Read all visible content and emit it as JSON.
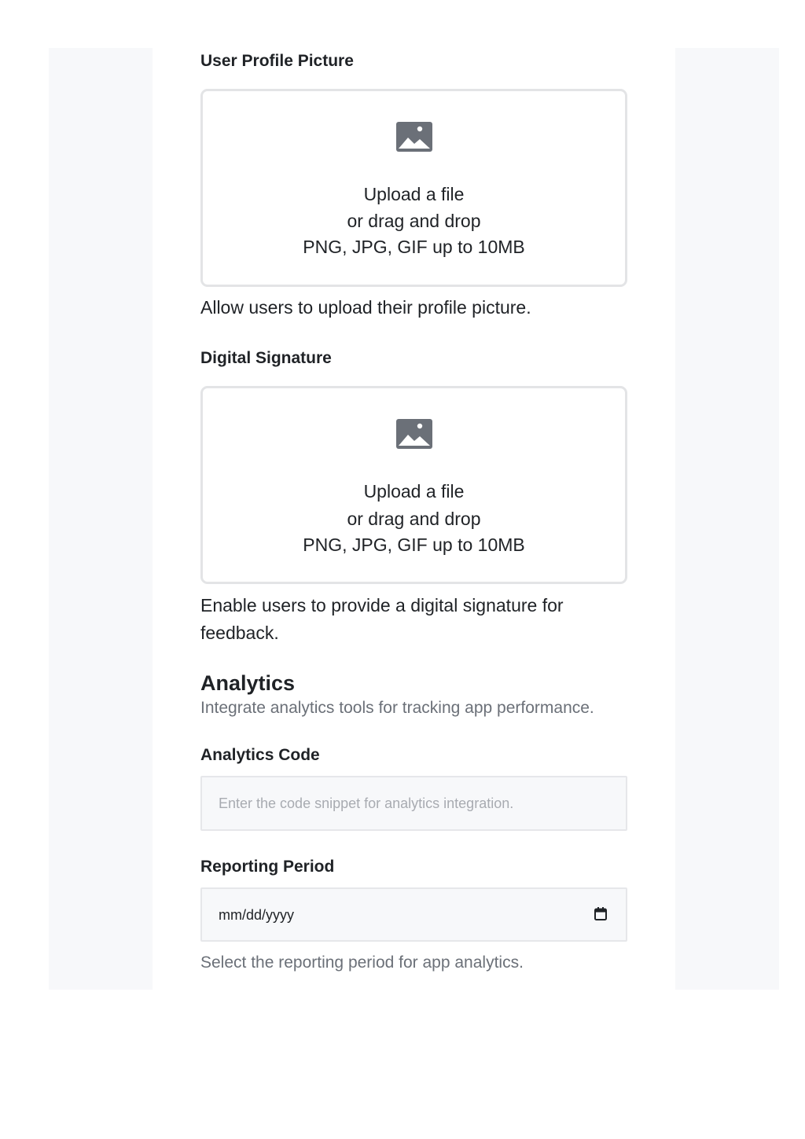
{
  "profile_picture": {
    "label": "User Profile Picture",
    "icon": "image-icon",
    "upload_link": "Upload a file",
    "drag_text": "or drag and drop",
    "formats": "PNG, JPG, GIF up to 10MB",
    "helper": "Allow users to upload their profile picture."
  },
  "signature": {
    "label": "Digital Signature",
    "icon": "image-icon",
    "upload_link": "Upload a file",
    "drag_text": "or drag and drop",
    "formats": "PNG, JPG, GIF up to 10MB",
    "helper_line1": "Enable users to provide a digital signature for",
    "helper_line2": "feedback."
  },
  "analytics": {
    "title": "Analytics",
    "description": "Integrate analytics tools for tracking app performance.",
    "code_label": "Analytics Code",
    "code_placeholder": "Enter the code snippet for analytics integration.",
    "code_value": "",
    "period_label": "Reporting Period",
    "period_placeholder": "mm/dd/yyyy",
    "period_icon": "calendar-icon",
    "period_helper": "Select the reporting period for app analytics."
  },
  "colors": {
    "page_background": "#f7f8fa",
    "card_background": "#ffffff",
    "border": "#e3e4e6",
    "icon": "#6b7078",
    "muted_text": "#6b7078",
    "text": "#1f2226"
  }
}
